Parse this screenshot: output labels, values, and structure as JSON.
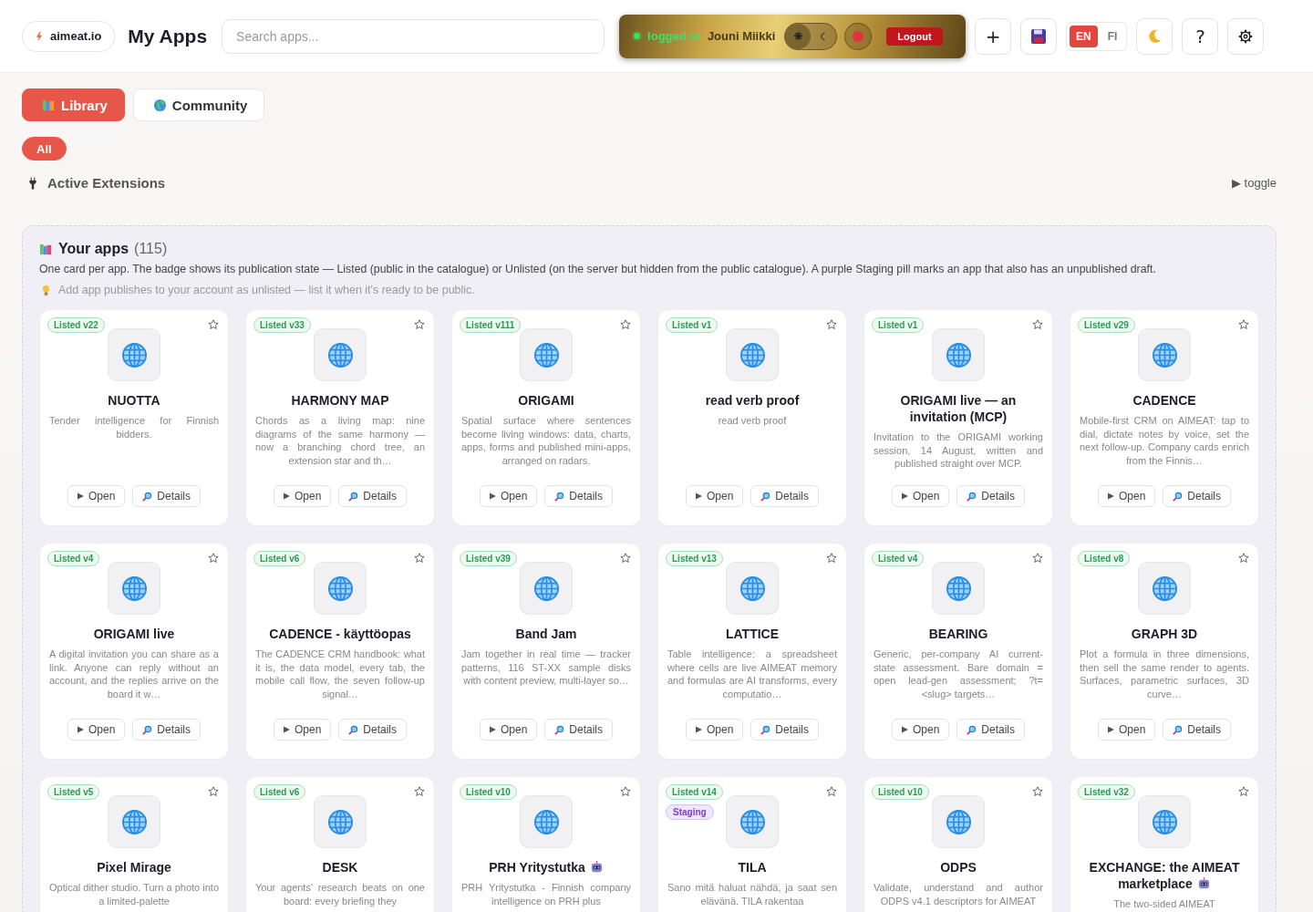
{
  "header": {
    "brand": "aimeat.io",
    "title": "My Apps",
    "search": {
      "placeholder": "Search apps..."
    },
    "session": {
      "status": "logged in",
      "user": "Jouni Miikki",
      "theme_dark": false,
      "logout": "Logout"
    },
    "add": "+",
    "languages": [
      {
        "label": "EN",
        "selected": true
      },
      {
        "label": "FI",
        "selected": false
      }
    ],
    "help": "?"
  },
  "tabs": [
    {
      "label": "Library",
      "selected": true
    },
    {
      "label": "Community",
      "selected": false
    }
  ],
  "filters": [
    {
      "label": "All",
      "selected": true
    }
  ],
  "extensions": {
    "title": "Active Extensions",
    "toggle": "▶ toggle"
  },
  "apps": {
    "title": "Your apps",
    "count": "(115)",
    "description": "One card per app. The badge shows its publication state — Listed (public in the catalogue) or Unlisted (on the server but hidden from the public catalogue). A purple Staging pill marks an app that also has an unpublished draft.",
    "hint": "Add app publishes to your account as unlisted — list it when it's ready to be public.",
    "cards": [
      {
        "badge": "Listed v22",
        "starred": false,
        "name": "NUOTTA",
        "description": "Tender intelligence for Finnish bidders.",
        "open": "Open",
        "details": "Details"
      },
      {
        "badge": "Listed v33",
        "starred": false,
        "name": "HARMONY MAP",
        "description": "Chords as a living map: nine diagrams of the same harmony — now a branching chord tree, an extension star and th…",
        "open": "Open",
        "details": "Details"
      },
      {
        "badge": "Listed v111",
        "starred": false,
        "name": "ORIGAMI",
        "description": "Spatial surface where sentences become living windows: data, charts, apps, forms and published mini-apps, arranged on radars.",
        "open": "Open",
        "details": "Details"
      },
      {
        "badge": "Listed v1",
        "starred": false,
        "name": "read verb proof",
        "description": "read verb proof",
        "open": "Open",
        "details": "Details"
      },
      {
        "badge": "Listed v1",
        "starred": false,
        "name": "ORIGAMI live — an invitation (MCP)",
        "description": "Invitation to the ORIGAMI working session, 14 August, written and published straight over MCP.",
        "open": "Open",
        "details": "Details"
      },
      {
        "badge": "Listed v29",
        "starred": false,
        "name": "CADENCE",
        "description": "Mobile-first CRM on AIMEAT: tap to dial, dictate notes by voice, set the next follow-up. Company cards enrich from the Finnis…",
        "open": "Open",
        "details": "Details"
      },
      {
        "badge": "Listed v4",
        "starred": false,
        "name": "ORIGAMI live",
        "description": "A digital invitation you can share as a link. Anyone can reply without an account, and the replies arrive on the board it w…",
        "open": "Open",
        "details": "Details"
      },
      {
        "badge": "Listed v6",
        "starred": false,
        "name": "CADENCE - käyttöopas",
        "description": "The CADENCE CRM handbook: what it is, the data model, every tab, the mobile call flow, the seven follow-up signal…",
        "open": "Open",
        "details": "Details"
      },
      {
        "badge": "Listed v39",
        "starred": false,
        "name": "Band Jam",
        "description": "Jam together in real time — tracker patterns, 116 ST-XX sample disks with content preview, multi-layer so…",
        "open": "Open",
        "details": "Details"
      },
      {
        "badge": "Listed v13",
        "starred": false,
        "name": "LATTICE",
        "description": "Table intelligence: a spreadsheet where cells are live AIMEAT memory and formulas are AI transforms, every computatio…",
        "open": "Open",
        "details": "Details"
      },
      {
        "badge": "Listed v4",
        "starred": false,
        "name": "BEARING",
        "description": "Generic, per-company AI current-state assessment. Bare domain = open lead-gen assessment; ?t=<slug> targets…",
        "open": "Open",
        "details": "Details"
      },
      {
        "badge": "Listed v8",
        "starred": false,
        "name": "GRAPH 3D",
        "description": "Plot a formula in three dimensions, then sell the same render to agents. Surfaces, parametric surfaces, 3D curve…",
        "open": "Open",
        "details": "Details"
      },
      {
        "badge": "Listed v5",
        "starred": false,
        "name": "Pixel Mirage",
        "description": "Optical dither studio. Turn a photo into a limited-palette"
      },
      {
        "badge": "Listed v6",
        "starred": false,
        "name": "DESK",
        "description": "Your agents' research beats on one board: every briefing they"
      },
      {
        "badge": "Listed v10",
        "starred": false,
        "name": "PRH Yritystutka",
        "robot": true,
        "description": "PRH Yritystutka - Finnish company intelligence on PRH plus"
      },
      {
        "badge": "Listed v14",
        "starred": false,
        "staging": "Staging",
        "name": "TILA",
        "description": "Sano mitä haluat nähdä, ja saat sen elävänä. TILA rakentaa"
      },
      {
        "badge": "Listed v10",
        "starred": false,
        "name": "ODPS",
        "description": "Validate, understand and author ODPS v4.1 descriptors for AIMEAT"
      },
      {
        "badge": "Listed v32",
        "starred": false,
        "name": "EXCHANGE: the AIMEAT marketplace",
        "robot": true,
        "description": "The two-sided AIMEAT"
      }
    ]
  }
}
